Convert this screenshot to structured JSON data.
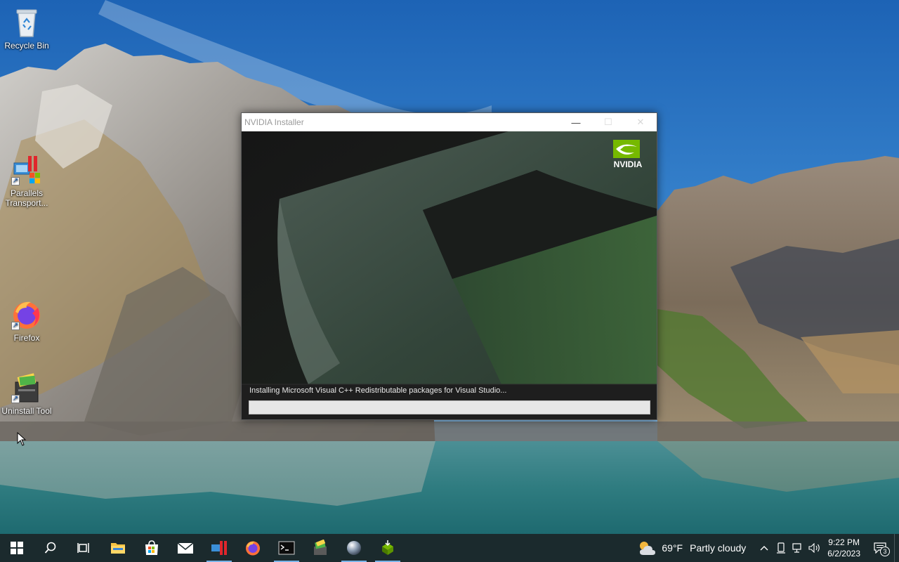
{
  "desktop": {
    "icons": [
      {
        "label": "Recycle Bin"
      },
      {
        "label": "Parallels Transport..."
      },
      {
        "label": "Firefox"
      },
      {
        "label": "Uninstall Tool"
      }
    ]
  },
  "installer": {
    "title": "NVIDIA Installer",
    "brand": "NVIDIA",
    "status": "Installing Microsoft Visual C++ Redistributable packages for Visual Studio...",
    "progress": 0.0,
    "colors": {
      "progress_fill": "#06b025",
      "brand_green": "#76b900"
    }
  },
  "taskbar": {
    "apps": [
      {
        "icon": "file-explorer-icon"
      },
      {
        "icon": "microsoft-store-icon"
      },
      {
        "icon": "mail-icon"
      },
      {
        "icon": "parallels-icon"
      },
      {
        "icon": "firefox-icon"
      },
      {
        "icon": "terminal-icon"
      },
      {
        "icon": "installer-tool-icon"
      },
      {
        "icon": "sphere-app-icon"
      },
      {
        "icon": "nvidia-installer-icon"
      }
    ],
    "weather": {
      "temp": "69°F",
      "condition": "Partly cloudy"
    },
    "clock": {
      "time": "9:22 PM",
      "date": "6/2/2023"
    },
    "notifications": "3"
  }
}
